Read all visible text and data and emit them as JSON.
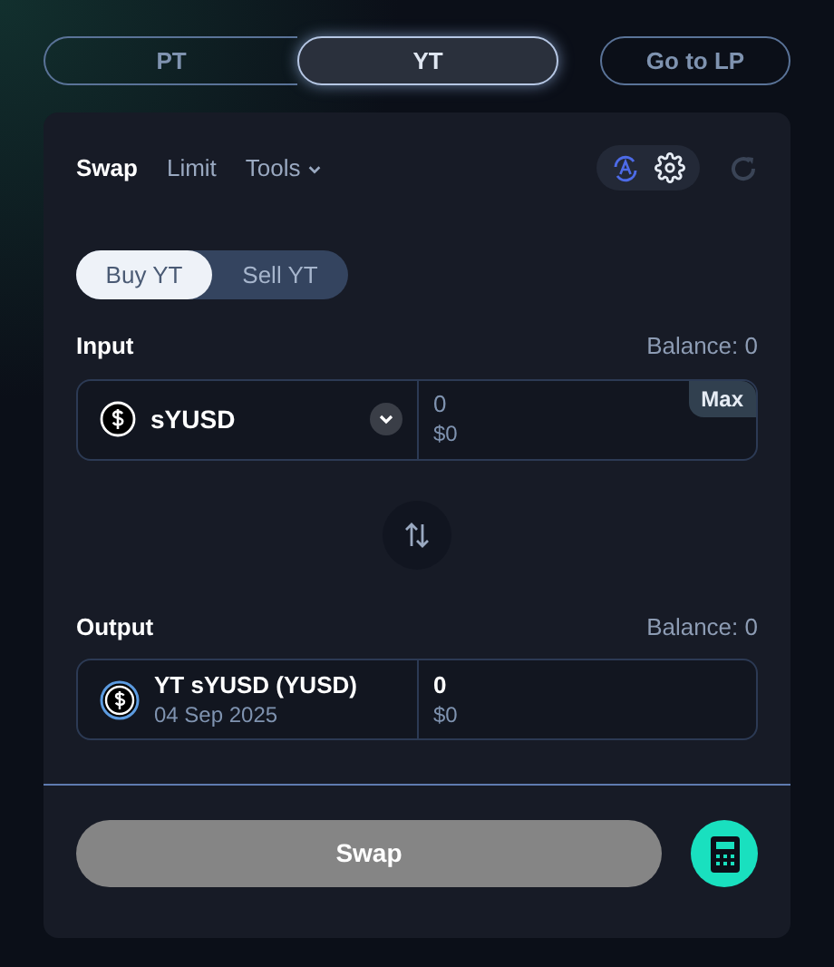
{
  "token_toggle": [
    {
      "label": "PT",
      "selected": false
    },
    {
      "label": "YT",
      "selected": true
    }
  ],
  "lp_button": {
    "label": "Go to LP"
  },
  "tabs": [
    {
      "label": "Swap",
      "selected": true,
      "kind": "tab"
    },
    {
      "label": "Limit",
      "selected": false,
      "kind": "tab"
    },
    {
      "label": "Tools",
      "selected": false,
      "kind": "dropdown"
    }
  ],
  "side_toggle": [
    {
      "label": "Buy YT",
      "selected": true
    },
    {
      "label": "Sell YT",
      "selected": false
    }
  ],
  "input": {
    "label": "Input",
    "balance": "Balance: 0",
    "token": "sYUSD",
    "amount_placeholder": "0",
    "usd": "$0",
    "max": "Max"
  },
  "output": {
    "label": "Output",
    "balance": "Balance: 0",
    "token": "YT sYUSD (YUSD)",
    "date": "04 Sep 2025",
    "amount": "0",
    "usd": "$0"
  },
  "swap_button": {
    "label": "Swap",
    "disabled": true
  }
}
